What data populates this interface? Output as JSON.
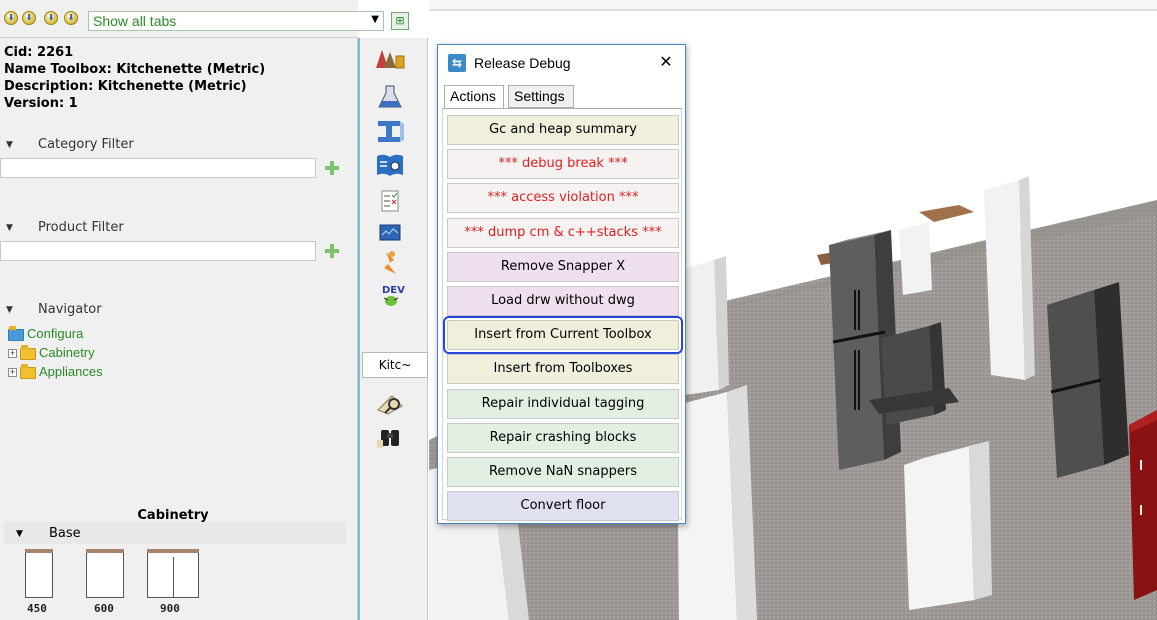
{
  "tab_bar": {
    "select_value": "Show all tabs",
    "nav_icons": [
      "arrow-down-circle-icon",
      "arrow-down-circle-icon",
      "arrow-down-circle-icon",
      "arrow-down-circle-icon"
    ]
  },
  "info": {
    "cid": "Cid: 2261",
    "name": "Name Toolbox: Kitchenette (Metric)",
    "description": "Description: Kitchenette (Metric)",
    "version": "Version: 1"
  },
  "category_filter": {
    "label": "Category Filter",
    "value": ""
  },
  "product_filter": {
    "label": "Product Filter",
    "value": ""
  },
  "navigator": {
    "label": "Navigator",
    "root": "Configura",
    "children": [
      "Cabinetry",
      "Appliances"
    ]
  },
  "cabinetry": {
    "title": "Cabinetry",
    "group": "Base",
    "items": [
      {
        "label": "450"
      },
      {
        "label": "600"
      },
      {
        "label": "900"
      }
    ]
  },
  "icon_bar": {
    "icons": [
      "palette-icon",
      "flask-icon",
      "beam-icon",
      "book-search-icon",
      "checklist-icon",
      "monitor-chart-icon",
      "runner-icon",
      "dev-bug-icon"
    ],
    "active_tab": "Kitc~",
    "bottom_icons": [
      "magnifier-icon",
      "binoculars-icon"
    ]
  },
  "dialog": {
    "title": "Release Debug",
    "tabs": [
      "Actions",
      "Settings"
    ],
    "active_tab": "Actions",
    "actions": [
      {
        "label": "Gc and heap summary",
        "color": "#000000",
        "bg": "#efefdc"
      },
      {
        "label": "*** debug break ***",
        "color": "#e02020",
        "bg": "#f7f2f2"
      },
      {
        "label": "*** access violation ***",
        "color": "#e02020",
        "bg": "#f7f2f2"
      },
      {
        "label": "*** dump cm & c++stacks ***",
        "color": "#e02020",
        "bg": "#f7f2f2"
      },
      {
        "label": "Remove Snapper X",
        "color": "#000000",
        "bg": "#efe0ef"
      },
      {
        "label": "Load drw without dwg",
        "color": "#000000",
        "bg": "#efe0ef"
      },
      {
        "label": "Insert from Current Toolbox",
        "color": "#000000",
        "bg": "#efefdc",
        "highlight": true
      },
      {
        "label": "Insert from Toolboxes",
        "color": "#000000",
        "bg": "#efefdc"
      },
      {
        "label": "Repair individual tagging",
        "color": "#000000",
        "bg": "#e2efe2"
      },
      {
        "label": "Repair crashing blocks",
        "color": "#000000",
        "bg": "#e2efe2"
      },
      {
        "label": "Remove NaN snappers",
        "color": "#000000",
        "bg": "#e2efe2"
      },
      {
        "label": "Convert floor",
        "color": "#000000",
        "bg": "#dfe0f0"
      }
    ]
  }
}
